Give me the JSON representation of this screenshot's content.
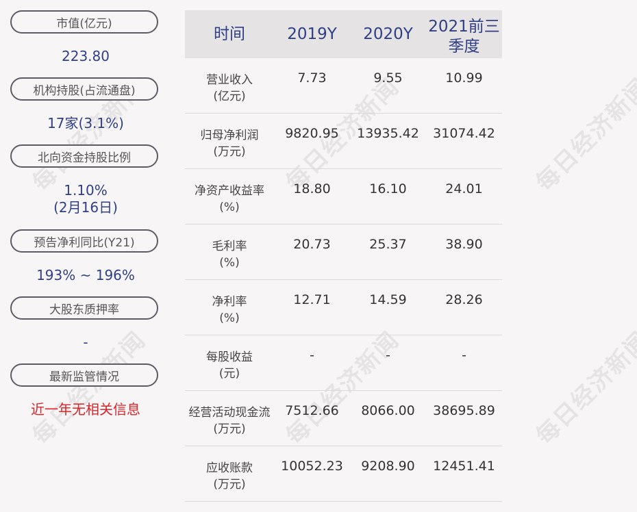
{
  "left_panel": {
    "items": [
      {
        "label": "市值(亿元)",
        "value": "223.80"
      },
      {
        "label": "机构持股(占流通盘)",
        "value": "17家(3.1%)"
      },
      {
        "label": "北向资金持股比例",
        "value_line1": "1.10%",
        "value_line2": "(2月16日)"
      },
      {
        "label": "预告净利同比(Y21)",
        "value": "193% ~ 196%"
      },
      {
        "label": "大股东质押率",
        "value": "-"
      },
      {
        "label": "最新监管情况",
        "value": "近一年无相关信息"
      }
    ]
  },
  "table": {
    "headers": [
      "时间",
      "2019Y",
      "2020Y",
      "2021前三季度"
    ],
    "rows": [
      {
        "label1": "营业收入",
        "label2": "(亿元)",
        "v2019": "7.73",
        "v2020": "9.55",
        "v2021": "10.99"
      },
      {
        "label1": "归母净利润",
        "label2": "(万元)",
        "v2019": "9820.95",
        "v2020": "13935.42",
        "v2021": "31074.42"
      },
      {
        "label1": "净资产收益率",
        "label2": "(%)",
        "v2019": "18.80",
        "v2020": "16.10",
        "v2021": "24.01"
      },
      {
        "label1": "毛利率",
        "label2": "(%)",
        "v2019": "20.73",
        "v2020": "25.37",
        "v2021": "38.90"
      },
      {
        "label1": "净利率",
        "label2": "(%)",
        "v2019": "12.71",
        "v2020": "14.59",
        "v2021": "28.26"
      },
      {
        "label1": "每股收益",
        "label2": "(元)",
        "v2019": "-",
        "v2020": "-",
        "v2021": "-"
      },
      {
        "label1": "经营活动现金流",
        "label2": "(万元)",
        "v2019": "7512.66",
        "v2020": "8066.00",
        "v2021": "38695.89"
      },
      {
        "label1": "应收账款",
        "label2": "(万元)",
        "v2019": "10052.23",
        "v2020": "9208.90",
        "v2021": "12451.41"
      }
    ]
  },
  "watermark": "每日经济新闻",
  "colors": {
    "value_blue": "#2e3f86",
    "alert_red": "#d6262a",
    "header_bg": "#e6e3e5"
  }
}
